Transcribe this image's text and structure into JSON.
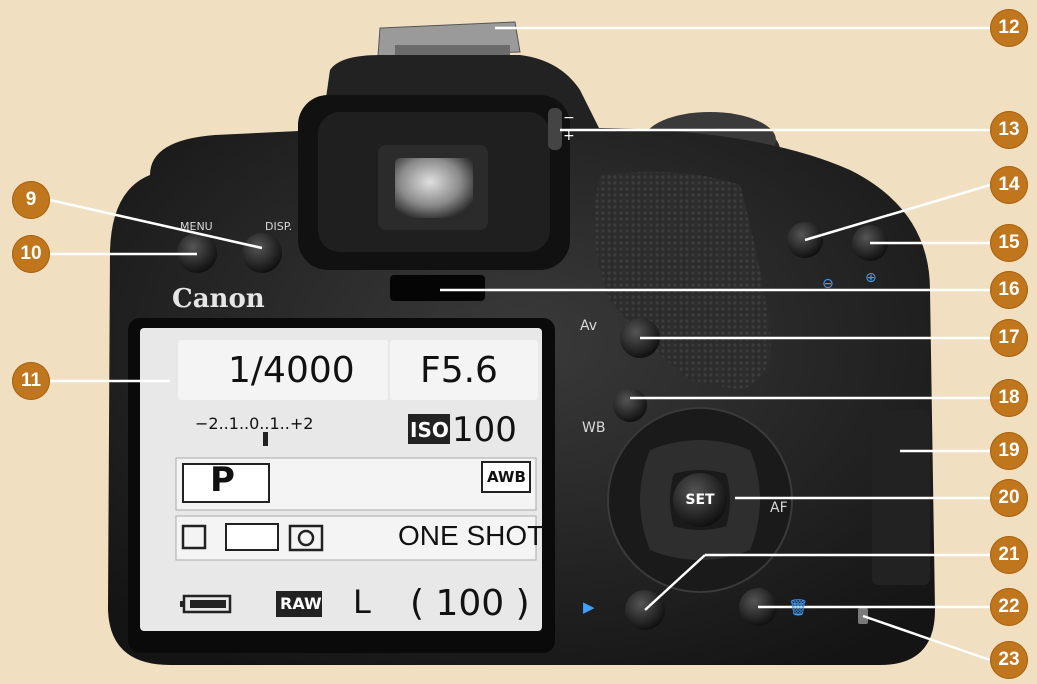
{
  "camera": {
    "brand": "Canon",
    "buttons": {
      "menu_label": "MENU",
      "disp_label": "DISP.",
      "av_label": "Av",
      "wb_label": "WB",
      "set_label": "SET",
      "af_label": "AF"
    },
    "diopter": {
      "minus": "−",
      "plus": "+"
    }
  },
  "lcd": {
    "shutter_speed": "1/4000",
    "aperture": "F5.6",
    "exposure_scale": "−2..1..0..1..+2",
    "iso_label": "ISO",
    "iso_value": "100",
    "mode": "P",
    "white_balance": "AWB",
    "af_mode": "ONE SHOT",
    "quality_raw": "RAW",
    "quality_jpeg": "L",
    "shots_remaining": "( 100 )"
  },
  "callouts": [
    "9",
    "10",
    "11",
    "12",
    "13",
    "14",
    "15",
    "16",
    "17",
    "18",
    "19",
    "20",
    "21",
    "22",
    "23"
  ],
  "colors": {
    "background": "#f1dfc2",
    "callout_fill": "#c0761c",
    "lcd_background": "#e8e8e8",
    "body": "#1a1a1a"
  }
}
